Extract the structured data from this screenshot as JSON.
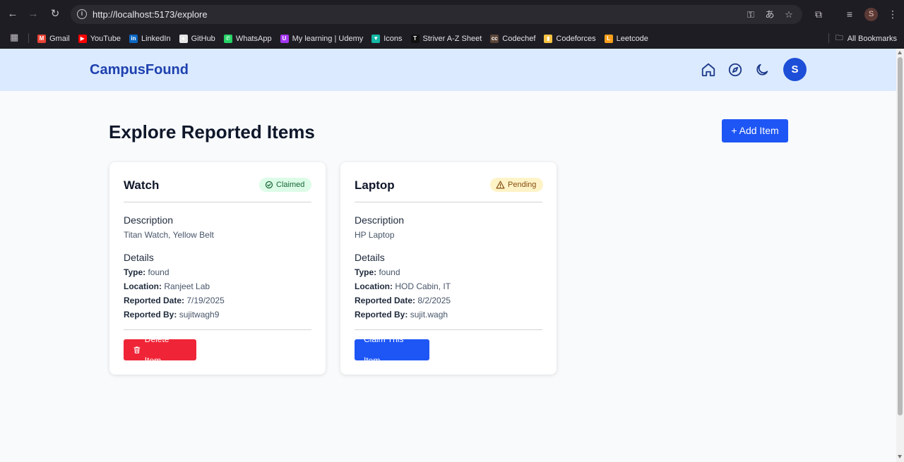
{
  "browser": {
    "url": "http://localhost:5173/explore",
    "profile_initial": "S",
    "bookmarks": [
      {
        "label": "Gmail",
        "color": "#ea4335",
        "glyph": "M"
      },
      {
        "label": "YouTube",
        "color": "#ff0000",
        "glyph": "▶"
      },
      {
        "label": "LinkedIn",
        "color": "#0a66c2",
        "glyph": "in"
      },
      {
        "label": "GitHub",
        "color": "#e6e6e6",
        "glyph": "●"
      },
      {
        "label": "WhatsApp",
        "color": "#25d366",
        "glyph": "✆"
      },
      {
        "label": "My learning | Udemy",
        "color": "#a435f0",
        "glyph": "U"
      },
      {
        "label": "Icons",
        "color": "#14b8a6",
        "glyph": "▼"
      },
      {
        "label": "Striver A-Z Sheet",
        "color": "#111111",
        "glyph": "T"
      },
      {
        "label": "Codechef",
        "color": "#5b4638",
        "glyph": "cc"
      },
      {
        "label": "Codeforces",
        "color": "#f6c343",
        "glyph": "▮"
      },
      {
        "label": "Leetcode",
        "color": "#f89f1b",
        "glyph": "L"
      }
    ],
    "all_bookmarks": "All Bookmarks"
  },
  "app": {
    "brand": "CampusFound",
    "avatar_initial": "S",
    "page_title": "Explore Reported Items",
    "add_button": "+ Add Item"
  },
  "labels": {
    "description": "Description",
    "details": "Details",
    "type": "Type:",
    "location": "Location:",
    "reported_date": "Reported Date:",
    "reported_by": "Reported By:"
  },
  "items": [
    {
      "title": "Watch",
      "status": "Claimed",
      "description": "Titan Watch, Yellow Belt",
      "type": "found",
      "location": "Ranjeet Lab",
      "reported_date": "7/19/2025",
      "reported_by": "sujitwagh9",
      "action": "Delete Item"
    },
    {
      "title": "Laptop",
      "status": "Pending",
      "description": "HP Laptop",
      "type": "found",
      "location": "HOD Cabin, IT",
      "reported_date": "8/2/2025",
      "reported_by": "sujit.wagh",
      "action": "Claim This Item"
    }
  ]
}
